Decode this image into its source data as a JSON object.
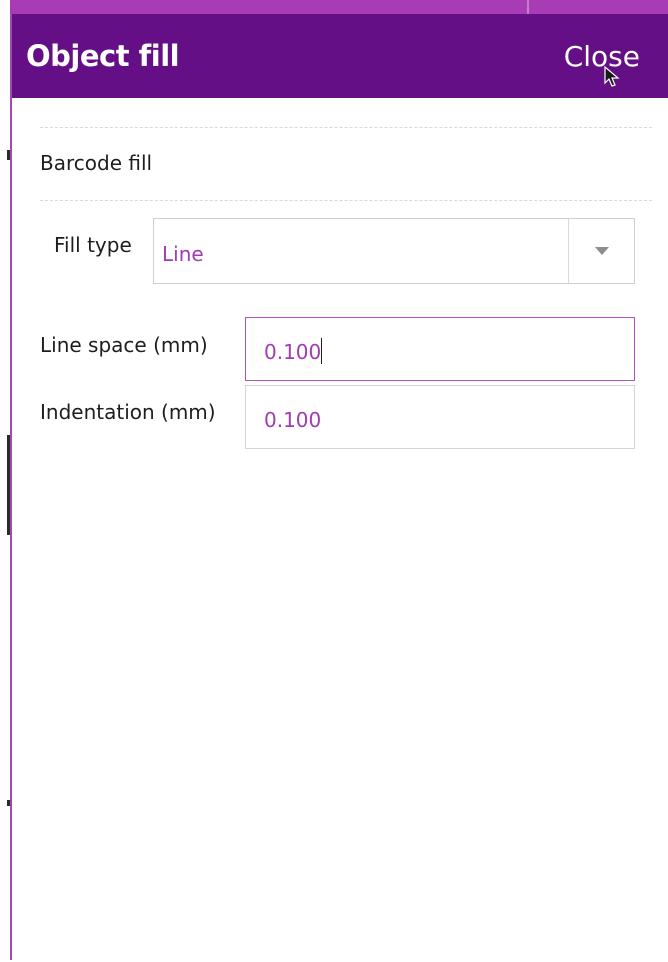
{
  "panel": {
    "title": "Object fill",
    "close_label": "Close"
  },
  "section": {
    "title": "Barcode fill"
  },
  "fill_type": {
    "label": "Fill type",
    "value": "Line"
  },
  "line_space": {
    "label": "Line space (mm)",
    "value": "0.100"
  },
  "indentation": {
    "label": "Indentation (mm)",
    "value": "0.100"
  },
  "colors": {
    "header_bg": "#650f86",
    "accent": "#a13cb3",
    "top_strip": "#a83cb4",
    "text": "#1e1e1e"
  },
  "icons": {
    "dropdown": "chevron-down-icon",
    "pointer": "mouse-pointer-icon"
  }
}
